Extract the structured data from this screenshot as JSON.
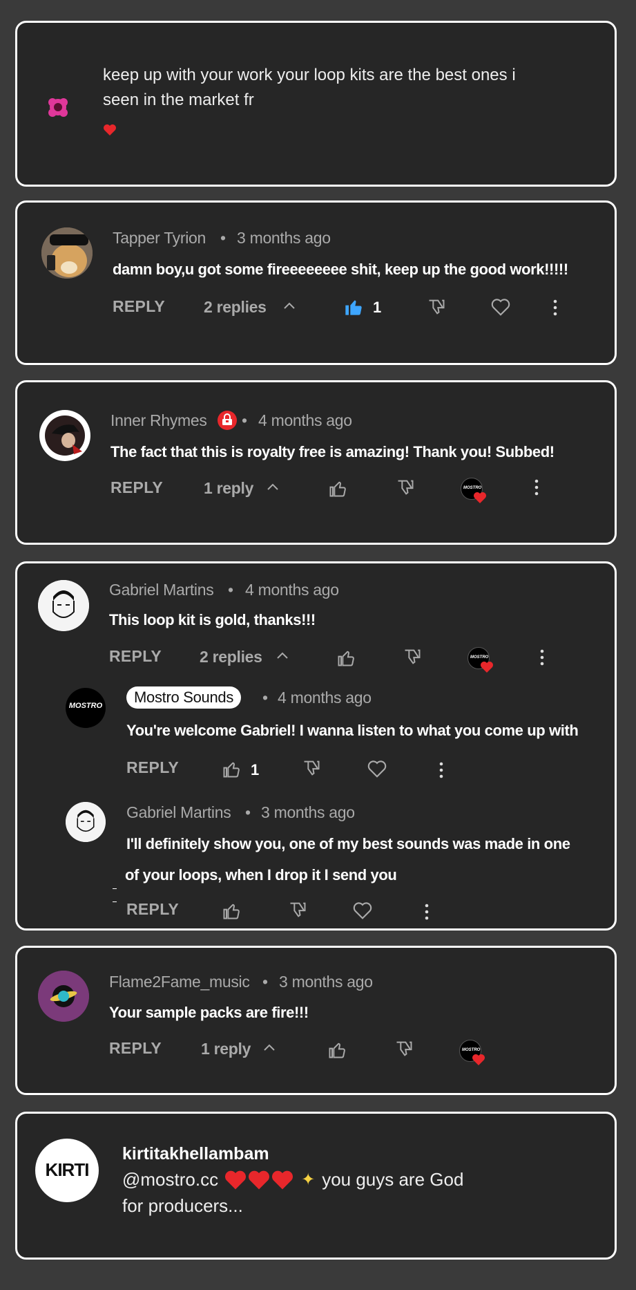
{
  "cards": {
    "c1": {
      "text_line1": "keep up with your work your loop kits are the best ones i",
      "text_line2": "seen in the market fr"
    },
    "c2": {
      "author": "Tapper Tyrion",
      "time": "3 months ago",
      "text": "damn boy,u got some fireeeeeeee shit, keep up the good work!!!!!",
      "reply_label": "REPLY",
      "replies": "2 replies",
      "likes": "1"
    },
    "c3": {
      "author": "Inner Rhymes",
      "time": "4 months ago",
      "text": "The fact that this is royalty free is amazing! Thank you! Subbed!",
      "reply_label": "REPLY",
      "replies": "1 reply"
    },
    "c4": {
      "author": "Gabriel Martins",
      "time": "4 months ago",
      "text": "This loop kit is gold, thanks!!!",
      "reply_label": "REPLY",
      "replies": "2 replies",
      "r1": {
        "author": "Mostro Sounds",
        "time": "4 months ago",
        "text": "You're welcome Gabriel! I wanna listen to what you come up with",
        "reply_label": "REPLY",
        "likes": "1",
        "avatar_text": "MOSTRO"
      },
      "r2": {
        "author": "Gabriel Martins",
        "time": "3 months ago",
        "text_line1": "I'll definitely show you, one of my best sounds was made in one",
        "text_line2": "of your loops, when I drop it I send you",
        "reply_label": "REPLY"
      }
    },
    "c5": {
      "author": "Flame2Fame_music",
      "time": "3 months ago",
      "text": "Your sample packs are fire!!!",
      "reply_label": "REPLY",
      "replies": "1 reply"
    },
    "c6": {
      "author": "kirtitakhellambam",
      "mention": "@mostro.cc",
      "text_after": "you guys are God",
      "text_line2": "for producers...",
      "avatar_text": "KIRTI"
    }
  },
  "dot": "•",
  "colors": {
    "background": "#3a3a3a",
    "card": "#262626",
    "like_active": "#3ea6ff",
    "heart_red": "#e8272b"
  }
}
